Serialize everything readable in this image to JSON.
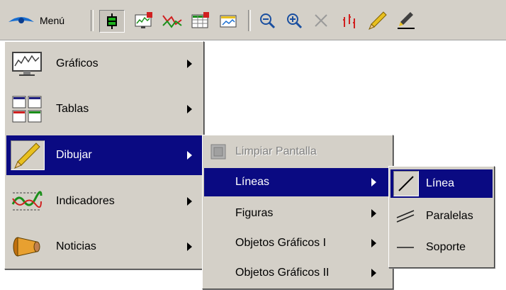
{
  "toolbar": {
    "menu_label": "Menú",
    "icons": [
      "eye-icon",
      "candlestick-icon",
      "chart-new-icon",
      "line-chart-icon",
      "table-new-icon",
      "chart-window-icon",
      "zoom-out-icon",
      "zoom-in-icon",
      "close-icon",
      "bar-chart-icon",
      "pencil-icon",
      "draw-line-icon"
    ]
  },
  "main_menu": {
    "items": [
      {
        "label": "Gráficos",
        "icon": "monitor-chart-icon",
        "has_submenu": true
      },
      {
        "label": "Tablas",
        "icon": "tables-icon",
        "has_submenu": true
      },
      {
        "label": "Dibujar",
        "icon": "pencil-icon",
        "has_submenu": true,
        "selected": true
      },
      {
        "label": "Indicadores",
        "icon": "indicator-icon",
        "has_submenu": true
      },
      {
        "label": "Noticias",
        "icon": "megaphone-icon",
        "has_submenu": true
      }
    ]
  },
  "draw_menu": {
    "clear_screen": "Limpiar Pantalla",
    "items": [
      {
        "label": "Líneas",
        "selected": true,
        "has_submenu": true
      },
      {
        "label": "Figuras",
        "has_submenu": true
      },
      {
        "label": "Objetos Gráficos I",
        "has_submenu": true
      },
      {
        "label": "Objetos Gráficos II",
        "has_submenu": true
      }
    ]
  },
  "lines_menu": {
    "items": [
      {
        "label": "Línea",
        "icon": "line-icon",
        "selected": true
      },
      {
        "label": "Paralelas",
        "icon": "parallel-lines-icon"
      },
      {
        "label": "Soporte",
        "icon": "horizontal-line-icon"
      }
    ]
  },
  "colors": {
    "menu_bg": "#d4d0c8",
    "selection": "#0a0a82"
  }
}
